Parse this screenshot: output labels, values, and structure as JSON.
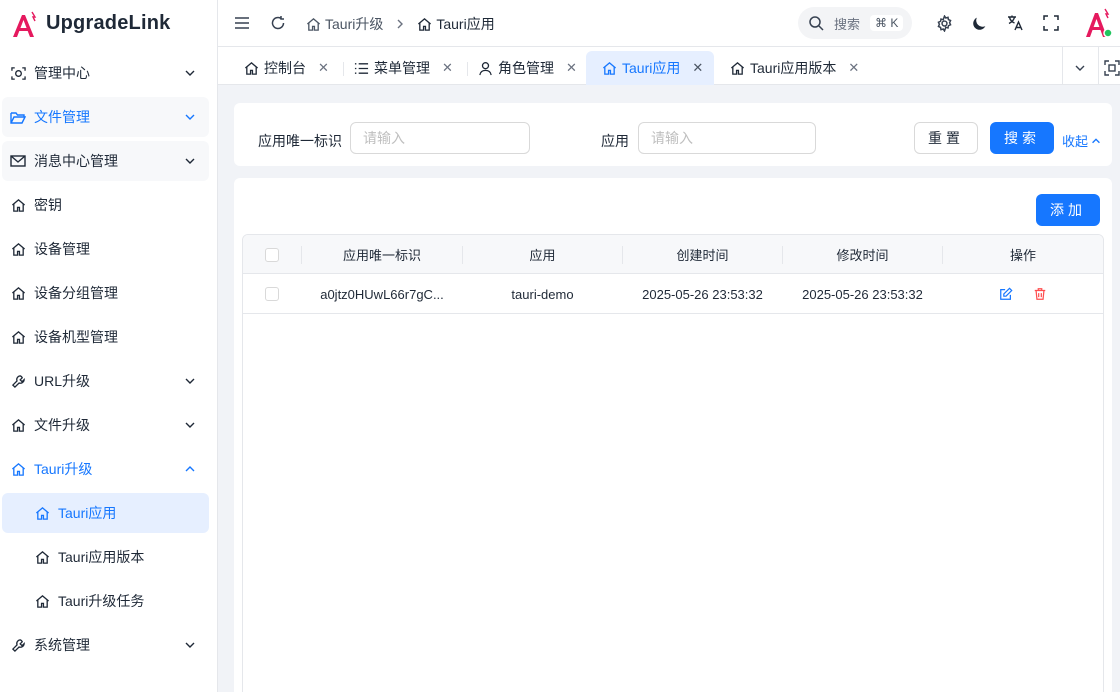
{
  "app": {
    "title": "UpgradeLink"
  },
  "colors": {
    "primary": "#1677ff",
    "danger": "#ff4d4f",
    "logo": "#e5195e",
    "online": "#22c55e"
  },
  "sidebar": {
    "items": [
      {
        "label": "管理中心",
        "icon": "dashboard-scan-icon",
        "chevron": "down"
      },
      {
        "label": "文件管理",
        "icon": "folder-open-icon",
        "chevron": "down"
      },
      {
        "label": "消息中心管理",
        "icon": "mail-icon",
        "chevron": "down"
      },
      {
        "label": "密钥",
        "icon": "home-icon"
      },
      {
        "label": "设备管理",
        "icon": "home-icon"
      },
      {
        "label": "设备分组管理",
        "icon": "home-icon"
      },
      {
        "label": "设备机型管理",
        "icon": "home-icon"
      },
      {
        "label": "URL升级",
        "icon": "wrench-icon",
        "chevron": "down"
      },
      {
        "label": "文件升级",
        "icon": "home-icon",
        "chevron": "down"
      },
      {
        "label": "Tauri升级",
        "icon": "home-icon",
        "chevron": "up"
      },
      {
        "label": "Tauri应用",
        "icon": "home-icon"
      },
      {
        "label": "Tauri应用版本",
        "icon": "home-icon"
      },
      {
        "label": "Tauri升级任务",
        "icon": "home-icon"
      },
      {
        "label": "系统管理",
        "icon": "wrench-icon",
        "chevron": "down"
      }
    ]
  },
  "header": {
    "breadcrumb": [
      "Tauri升级",
      "Tauri应用"
    ],
    "search_label": "搜索",
    "search_shortcut": "⌘ K"
  },
  "tabs": [
    {
      "label": "控制台",
      "icon": "home-icon"
    },
    {
      "label": "菜单管理",
      "icon": "list-icon"
    },
    {
      "label": "角色管理",
      "icon": "user-icon"
    },
    {
      "label": "Tauri应用",
      "icon": "home-icon",
      "active": true
    },
    {
      "label": "Tauri应用版本",
      "icon": "home-icon"
    }
  ],
  "filter": {
    "app_key_label": "应用唯一标识",
    "app_key_placeholder": "请输入",
    "app_label": "应用",
    "app_placeholder": "请输入",
    "reset_label": "重置",
    "search_label": "搜索",
    "collapse_label": "收起"
  },
  "table": {
    "add_label": "添加",
    "columns": [
      "应用唯一标识",
      "应用",
      "创建时间",
      "修改时间",
      "操作"
    ],
    "rows": [
      {
        "app_key": "a0jtz0HUwL66r7gC...",
        "app": "tauri-demo",
        "created": "2025-05-26 23:53:32",
        "modified": "2025-05-26 23:53:32"
      }
    ]
  }
}
